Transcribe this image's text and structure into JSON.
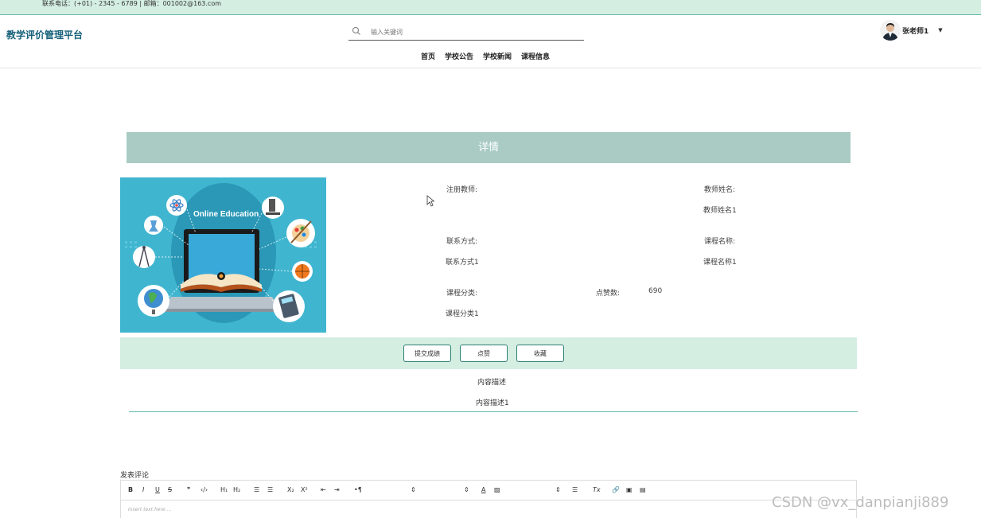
{
  "topbar": {
    "contact": "联系电话：(+01) - 2345 - 6789 | 邮箱：001002@163.com"
  },
  "header": {
    "brand": "教学评价管理平台",
    "search_placeholder": "输入关键词",
    "nav": [
      "首页",
      "学校公告",
      "学校新闻",
      "课程信息"
    ],
    "user_name": "张老师1"
  },
  "detail": {
    "title": "详情",
    "image_text": "Online Education",
    "fields": {
      "teacher_label": "注册教师:",
      "teacher_name_label": "教师姓名:",
      "teacher_name_value": "教师姓名1",
      "contact_label": "联系方式:",
      "contact_value": "联系方式1",
      "course_name_label": "课程名称:",
      "course_name_value": "课程名称1",
      "category_label": "课程分类:",
      "category_value": "课程分类1",
      "likes_label": "点赞数:",
      "likes_value": "690"
    },
    "buttons": {
      "submit": "提交成绩",
      "like": "点赞",
      "favorite": "收藏"
    },
    "desc_label": "内容描述",
    "desc_value": "内容描述1"
  },
  "comment": {
    "label": "发表评论",
    "editor_placeholder": "Insert text here ...",
    "toolbar": [
      "B",
      "I",
      "U",
      "S",
      "❞",
      "‹/›",
      "H₁",
      "H₂",
      "☰",
      "☰",
      "X₂",
      "X²",
      "⇤",
      "⇥",
      "•¶",
      "⇕",
      "⇕",
      "A",
      "▨",
      "⇕",
      "☰",
      "Tx",
      "🔗",
      "▣",
      "▤"
    ]
  },
  "watermark": "CSDN @vx_danpianji889"
}
